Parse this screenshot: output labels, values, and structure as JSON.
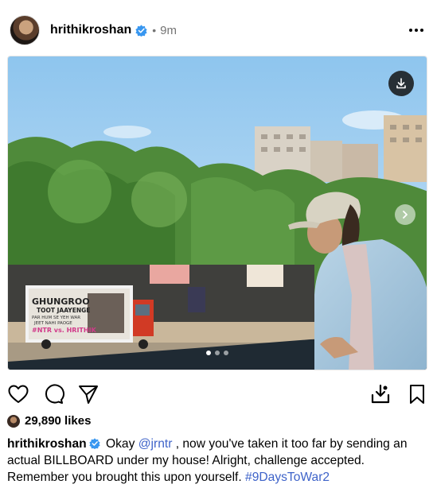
{
  "post": {
    "username": "hrithikroshan",
    "separator": "•",
    "time": "9m",
    "likes": "29,890 likes",
    "caption": {
      "username": "hrithikroshan",
      "text_before_mention": " Okay ",
      "mention": "@jrntr",
      "text_after_mention": " , now you've taken it too far by sending an actual BILLBOARD under my house! Alright, challenge accepted. Remember you brought this upon yourself. ",
      "hashtag": "#9DaysToWar2"
    }
  },
  "media": {
    "truck_text": {
      "line1": "GHUNGROO",
      "line2": "TOOT JAAYENGE",
      "line3": "PAR HUM SE YEH WAR",
      "line4": "JEET NAHI PAOGE",
      "line5": "#NTR vs. HRITHIK"
    },
    "carousel": {
      "count": 3,
      "active": 1
    }
  },
  "icons": {
    "verified": "verified-badge-icon",
    "more": "more-options-icon",
    "download": "download-icon",
    "next": "chevron-right-icon",
    "like": "heart-icon",
    "comment": "comment-icon",
    "share": "share-icon",
    "save_to": "save-download-icon",
    "bookmark": "bookmark-icon"
  },
  "colors": {
    "accent": "#3e63c9",
    "verified": "#3897f0",
    "muted": "#737373"
  }
}
